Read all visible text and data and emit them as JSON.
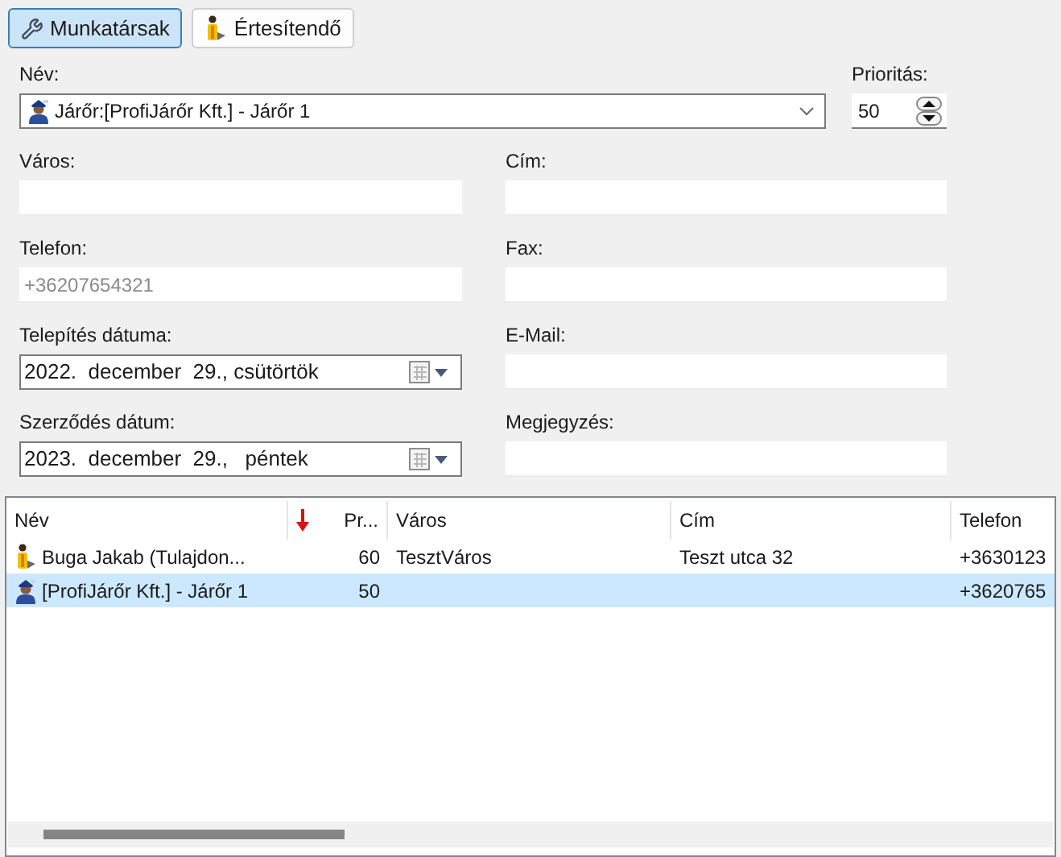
{
  "tabs": [
    {
      "label": "Munkatársak",
      "kind": "wrench",
      "selected": true
    },
    {
      "label": "Értesítendő",
      "kind": "contact",
      "selected": false
    }
  ],
  "name": {
    "label": "Név:",
    "value": "Járőr:[ProfiJárőr Kft.] - Járőr 1",
    "kind": "guard"
  },
  "priority": {
    "label": "Prioritás:",
    "value": "50"
  },
  "fields": [
    {
      "label": "Város:",
      "kind": "text"
    },
    {
      "label": "Cím:",
      "kind": "text"
    },
    {
      "label": "Telefon:",
      "kind": "text",
      "placeholder": "+36207654321"
    },
    {
      "label": "Fax:",
      "kind": "text"
    },
    {
      "label": "Telepítés dátuma:",
      "kind": "date",
      "value": "2022.  december  29., csütörtök"
    },
    {
      "label": "E-Mail:",
      "kind": "text"
    },
    {
      "label": "Szerződés dátum:",
      "kind": "date",
      "value": "2023.  december  29.,   péntek"
    },
    {
      "label": "Megjegyzés:",
      "kind": "text"
    }
  ],
  "table": {
    "columns": [
      {
        "label": "Név",
        "sorted": false
      },
      {
        "label": "Pr...",
        "sorted": true
      },
      {
        "label": "Város",
        "sorted": false
      },
      {
        "label": "Cím",
        "sorted": false
      },
      {
        "label": "Telefon",
        "sorted": false
      }
    ],
    "rows": [
      {
        "kind": "contact",
        "selected": false,
        "name": "Buga Jakab (Tulajdon...",
        "priority": "60",
        "city": "TesztVáros",
        "address": "Teszt utca 32",
        "phone": "+3630123"
      },
      {
        "kind": "guard",
        "selected": true,
        "name": "[ProfiJárőr Kft.] - Járőr 1",
        "priority": "50",
        "phone": "+3620765"
      }
    ]
  }
}
